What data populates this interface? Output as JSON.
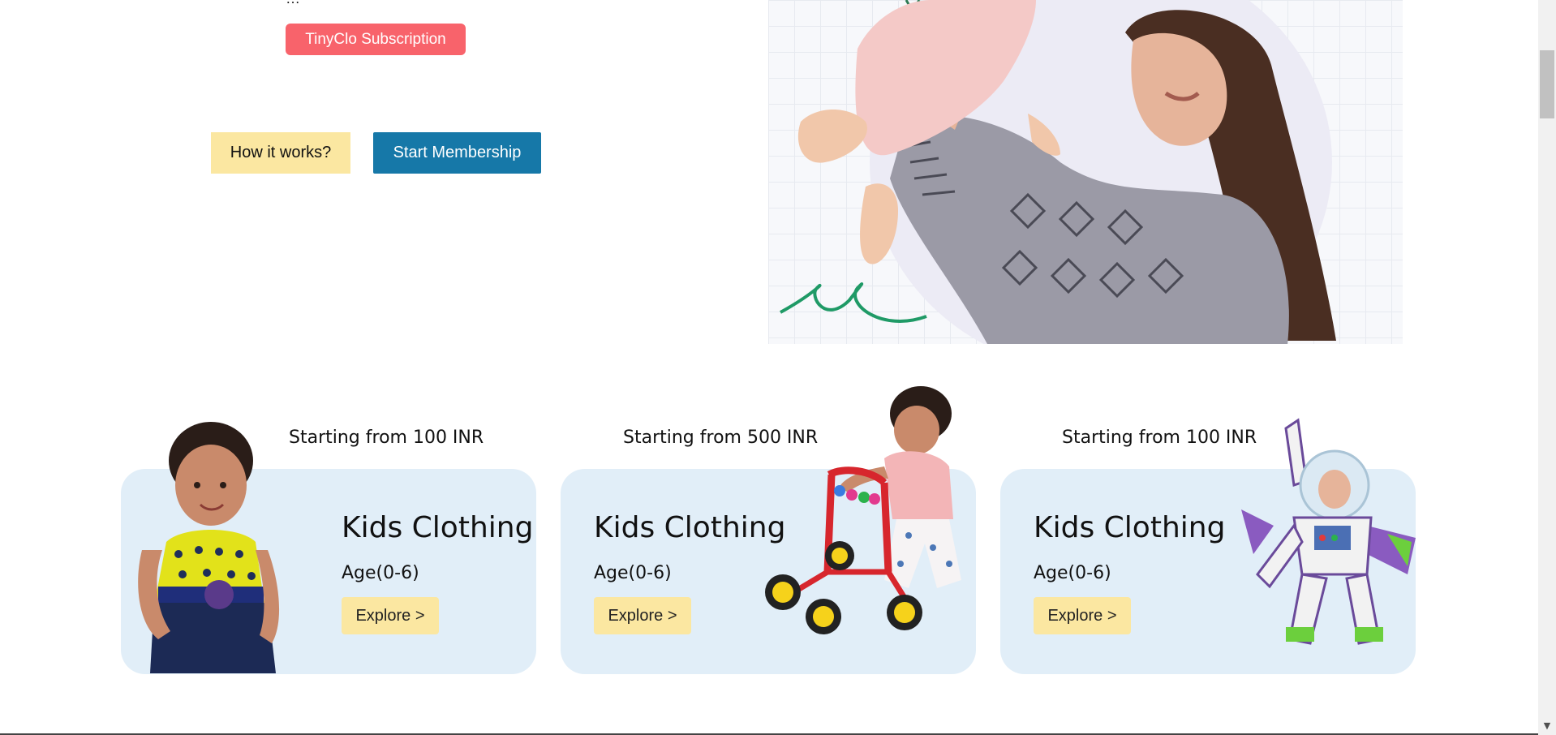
{
  "hero": {
    "subscription_label": "TinyClo Subscription",
    "how_it_works_label": "How it works?",
    "start_membership_label": "Start Membership"
  },
  "categories": [
    {
      "starting": "Starting from 100 INR",
      "title": "Kids Clothing",
      "age": "Age(0-6)",
      "explore": "Explore >",
      "image": "girl-in-dress"
    },
    {
      "starting": "Starting from 500 INR",
      "title": "Kids Clothing",
      "age": "Age(0-6)",
      "explore": "Explore >",
      "image": "toddler-with-walker"
    },
    {
      "starting": "Starting from 100 INR",
      "title": "Kids Clothing",
      "age": "Age(0-6)",
      "explore": "Explore >",
      "image": "space-ranger-toy"
    }
  ],
  "colors": {
    "subscription": "#f8636b",
    "how_it_works": "#fbe7a1",
    "start_membership": "#1678a8",
    "card_bg": "#e1eef8",
    "explore": "#fbe7a1"
  }
}
